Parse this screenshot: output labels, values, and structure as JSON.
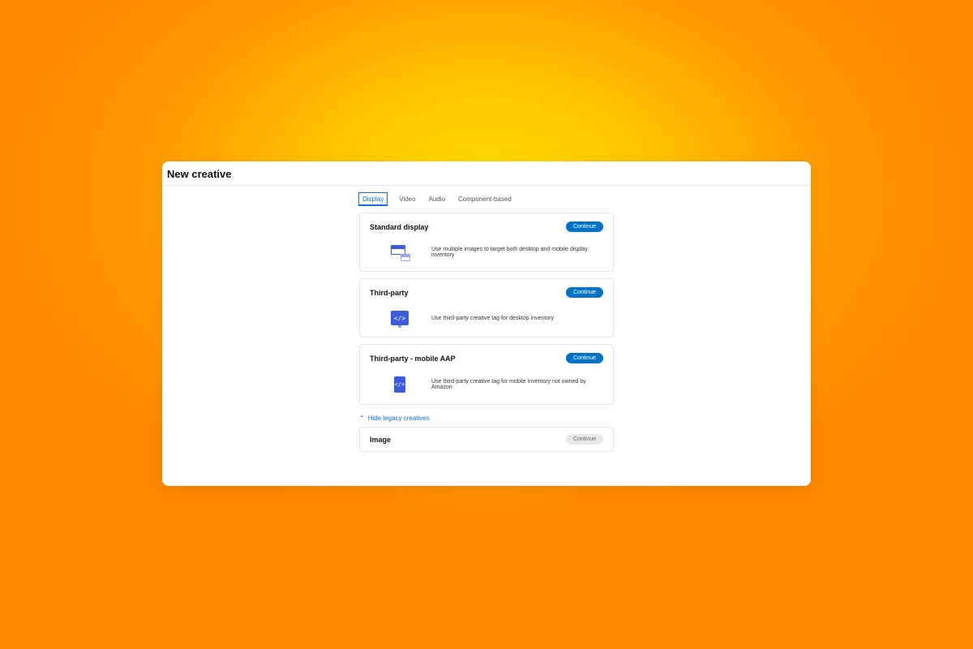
{
  "page_title": "New creative",
  "tabs": [
    {
      "label": "Display",
      "active": true
    },
    {
      "label": "Video",
      "active": false
    },
    {
      "label": "Audio",
      "active": false
    },
    {
      "label": "Component-based",
      "active": false
    }
  ],
  "cards": [
    {
      "title": "Standard display",
      "button": "Continue",
      "icon": "display-icon",
      "description": "Use multiple images to target both desktop and mobile display inventory"
    },
    {
      "title": "Third-party",
      "button": "Continue",
      "icon": "code-icon",
      "description": "Use third-party creative tag for desktop inventory"
    },
    {
      "title": "Third-party - mobile AAP",
      "button": "Continue",
      "icon": "mobile-code-icon",
      "description": "Use third-party creative tag for mobile inventory not owned by Amazon"
    }
  ],
  "legacy_toggle": "Hide legacy creatives",
  "legacy_card": {
    "title": "Image",
    "button": "Continue"
  }
}
